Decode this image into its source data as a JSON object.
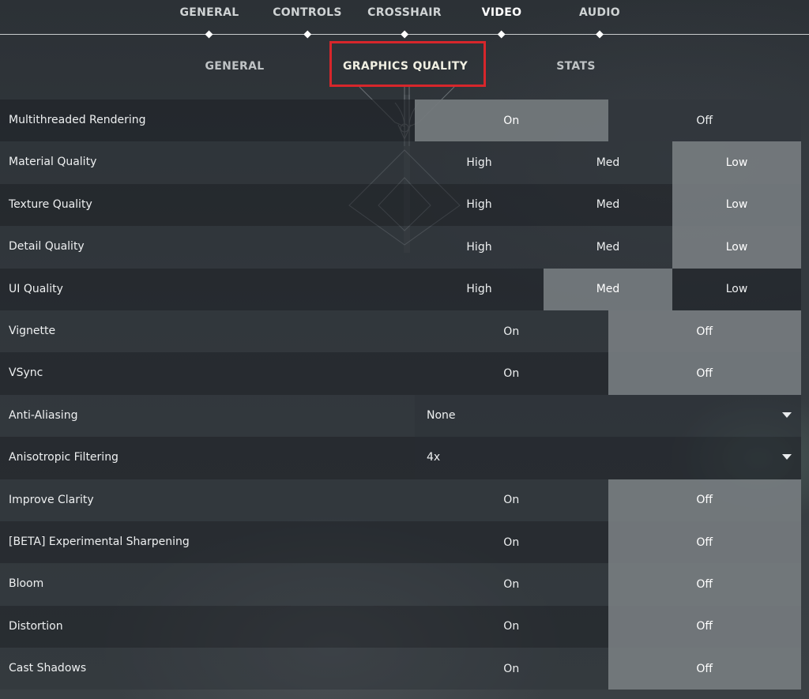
{
  "top_nav": {
    "tabs": [
      {
        "label": "GENERAL",
        "active": false
      },
      {
        "label": "CONTROLS",
        "active": false
      },
      {
        "label": "CROSSHAIR",
        "active": false
      },
      {
        "label": "VIDEO",
        "active": true
      },
      {
        "label": "AUDIO",
        "active": false
      }
    ]
  },
  "sub_nav": {
    "tabs": [
      {
        "label": "GENERAL",
        "active": false
      },
      {
        "label": "GRAPHICS QUALITY",
        "active": true
      },
      {
        "label": "STATS",
        "active": false
      }
    ],
    "highlight_color": "#d7262b"
  },
  "settings": [
    {
      "label": "Multithreaded Rendering",
      "type": "toggle",
      "options": [
        "On",
        "Off"
      ],
      "selected": "On"
    },
    {
      "label": "Material Quality",
      "type": "toggle",
      "options": [
        "High",
        "Med",
        "Low"
      ],
      "selected": "Low"
    },
    {
      "label": "Texture Quality",
      "type": "toggle",
      "options": [
        "High",
        "Med",
        "Low"
      ],
      "selected": "Low"
    },
    {
      "label": "Detail Quality",
      "type": "toggle",
      "options": [
        "High",
        "Med",
        "Low"
      ],
      "selected": "Low"
    },
    {
      "label": "UI Quality",
      "type": "toggle",
      "options": [
        "High",
        "Med",
        "Low"
      ],
      "selected": "Med"
    },
    {
      "label": "Vignette",
      "type": "toggle",
      "options": [
        "On",
        "Off"
      ],
      "selected": "Off"
    },
    {
      "label": "VSync",
      "type": "toggle",
      "options": [
        "On",
        "Off"
      ],
      "selected": "Off"
    },
    {
      "label": "Anti-Aliasing",
      "type": "dropdown",
      "value": "None"
    },
    {
      "label": "Anisotropic Filtering",
      "type": "dropdown",
      "value": "4x"
    },
    {
      "label": "Improve Clarity",
      "type": "toggle",
      "options": [
        "On",
        "Off"
      ],
      "selected": "Off"
    },
    {
      "label": "[BETA] Experimental Sharpening",
      "type": "toggle",
      "options": [
        "On",
        "Off"
      ],
      "selected": "Off"
    },
    {
      "label": "Bloom",
      "type": "toggle",
      "options": [
        "On",
        "Off"
      ],
      "selected": "Off"
    },
    {
      "label": "Distortion",
      "type": "toggle",
      "options": [
        "On",
        "Off"
      ],
      "selected": "Off"
    },
    {
      "label": "Cast Shadows",
      "type": "toggle",
      "options": [
        "On",
        "Off"
      ],
      "selected": "Off"
    }
  ],
  "icons": {
    "dropdown": "chevron-down-icon",
    "tab_marker": "diamond-marker-icon"
  }
}
